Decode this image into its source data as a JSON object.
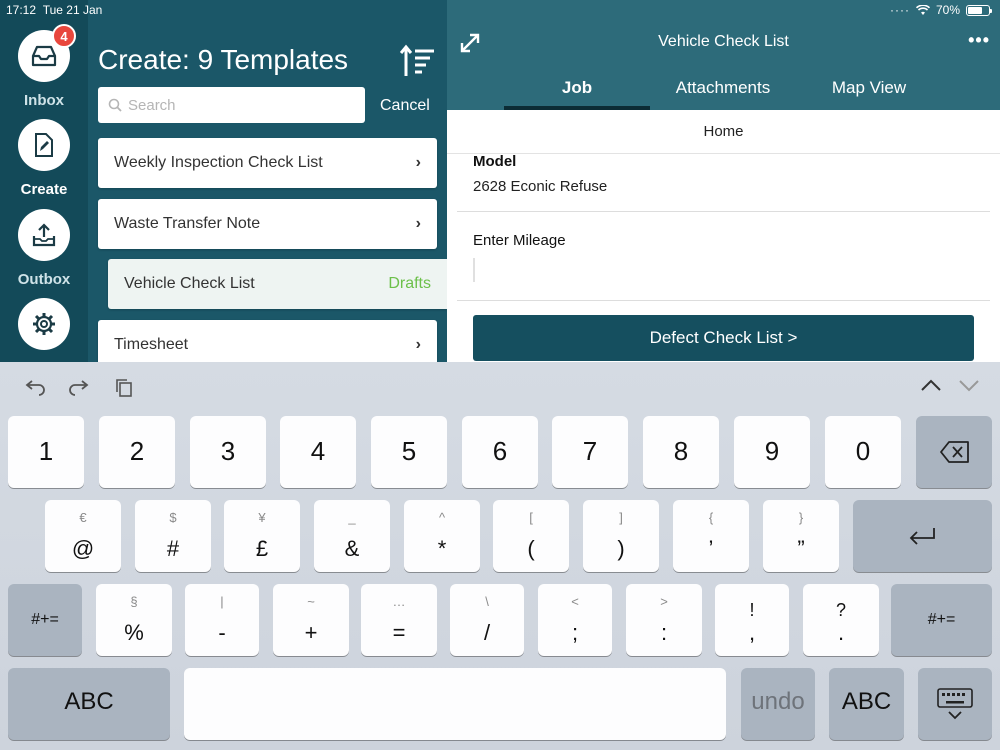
{
  "status_bar": {
    "time": "17:12",
    "date": "Tue 21 Jan",
    "battery": "70%",
    "battery_level": 0.7
  },
  "rail": {
    "inbox_label": "Inbox",
    "inbox_badge": "4",
    "create_label": "Create",
    "outbox_label": "Outbox"
  },
  "templates": {
    "title": "Create: 9 Templates",
    "search_placeholder": "Search",
    "cancel_label": "Cancel",
    "items": [
      {
        "label": "Weekly Inspection Check List"
      },
      {
        "label": "Waste Transfer Note"
      },
      {
        "label": "Vehicle Check List",
        "status": "Drafts"
      },
      {
        "label": "Timesheet"
      }
    ]
  },
  "detail": {
    "title": "Vehicle Check List",
    "tabs": [
      {
        "label": "Job"
      },
      {
        "label": "Attachments"
      },
      {
        "label": "Map View"
      }
    ],
    "section": "Home",
    "model_label": "Model",
    "model_value": "2628 Econic Refuse",
    "mileage_label": "Enter Mileage",
    "mileage_value": "",
    "defect_button": "Defect Check List >"
  },
  "keyboard": {
    "row1": [
      "1",
      "2",
      "3",
      "4",
      "5",
      "6",
      "7",
      "8",
      "9",
      "0"
    ],
    "row2": [
      {
        "main": "@",
        "sub": "€"
      },
      {
        "main": "#",
        "sub": "$"
      },
      {
        "main": "£",
        "sub": "¥"
      },
      {
        "main": "&",
        "sub": "_"
      },
      {
        "main": "*",
        "sub": "^"
      },
      {
        "main": "(",
        "sub": "["
      },
      {
        "main": ")",
        "sub": "]"
      },
      {
        "main": "’",
        "sub": "{"
      },
      {
        "main": "”",
        "sub": "}"
      }
    ],
    "row3": [
      {
        "main": "%",
        "sub": "§"
      },
      {
        "main": "-",
        "sub": "|"
      },
      {
        "main": "+",
        "sub": "~"
      },
      {
        "main": "=",
        "sub": "…"
      },
      {
        "main": "/",
        "sub": "\\"
      },
      {
        "main": ";",
        "sub": "<"
      },
      {
        "main": ":",
        "sub": ">"
      },
      {
        "main": ",",
        "sub": "!"
      },
      {
        "main": ".",
        "sub": "?"
      }
    ],
    "shift_label": "#+=",
    "abc_label": "ABC",
    "undo_label": "undo"
  }
}
